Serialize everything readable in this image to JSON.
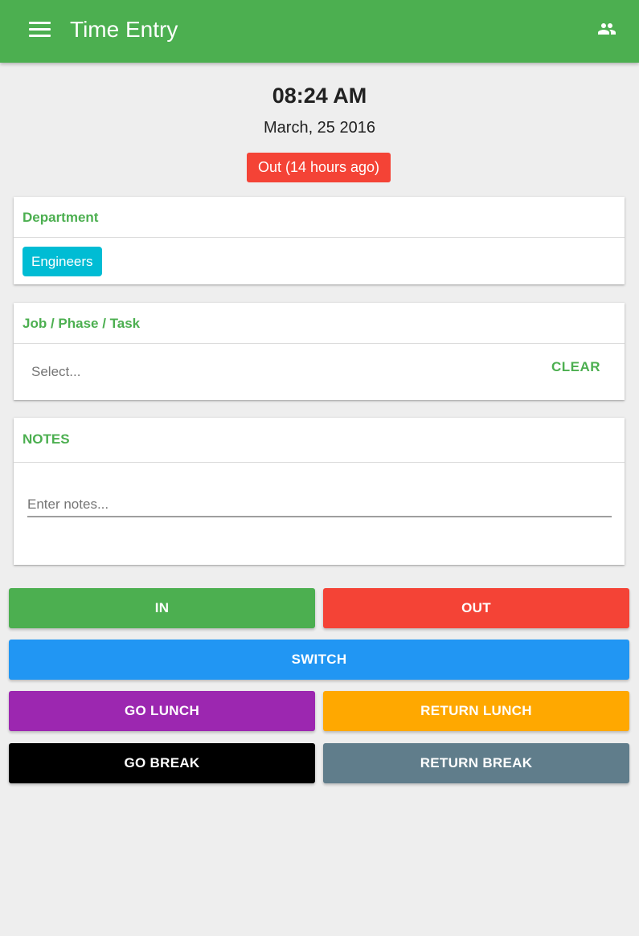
{
  "appbar": {
    "title": "Time Entry",
    "menu_icon": "hamburger-menu-icon",
    "people_icon": "people-icon"
  },
  "clock": {
    "time": "08:24 AM",
    "date": "March, 25 2016",
    "status": "Out (14 hours ago)"
  },
  "department": {
    "header": "Department",
    "selected": "Engineers"
  },
  "job": {
    "header": "Job / Phase / Task",
    "placeholder": "Select...",
    "clear_label": "CLEAR"
  },
  "notes": {
    "header": "NOTES",
    "placeholder": "Enter notes...",
    "value": ""
  },
  "actions": {
    "in": "IN",
    "out": "OUT",
    "switch": "SWITCH",
    "go_lunch": "GO LUNCH",
    "return_lunch": "RETURN LUNCH",
    "go_break": "GO BREAK",
    "return_break": "RETURN BREAK"
  },
  "colors": {
    "primary": "#4caf50",
    "danger": "#f44336",
    "info": "#2196f3",
    "accent_chip": "#00bcd4",
    "lunch_go": "#9c27b0",
    "lunch_return": "#ffa800",
    "break_go": "#000000",
    "break_return": "#607d8b",
    "background": "#eeeeee"
  }
}
